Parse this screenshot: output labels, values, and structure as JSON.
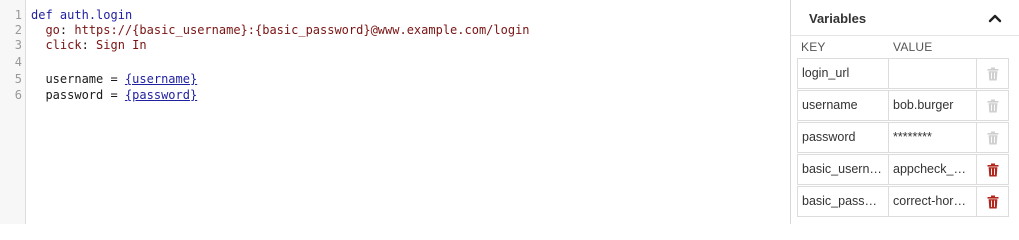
{
  "editor": {
    "line_numbers": [
      "1",
      "2",
      "3",
      "4",
      "5",
      "6"
    ],
    "line1": {
      "keyword": "def",
      "name": "auth.login"
    },
    "line2": {
      "prop": "go",
      "sep": ":",
      "url": "https://{basic_username}:{basic_password}@www.example.com/login"
    },
    "line3": {
      "prop": "click",
      "sep": ":",
      "value": "Sign In"
    },
    "line5": {
      "name": "username",
      "op": "=",
      "ref": "{username}"
    },
    "line6": {
      "name": "password",
      "op": "=",
      "ref": "{password}"
    }
  },
  "variables_panel": {
    "title": "Variables",
    "collapse_icon": "chevron-up-icon",
    "headers": {
      "key": "KEY",
      "value": "VALUE"
    },
    "rows": [
      {
        "key": "login_url",
        "value": "",
        "delete_enabled": false
      },
      {
        "key": "username",
        "value": "bob.burger",
        "delete_enabled": false
      },
      {
        "key": "password",
        "value": "********",
        "delete_enabled": false
      },
      {
        "key": "basic_username",
        "value": "appcheck_user",
        "delete_enabled": true
      },
      {
        "key": "basic_password",
        "value": "correct-horse-battery",
        "delete_enabled": true
      }
    ]
  },
  "colors": {
    "keyword": "#1f1fa0",
    "string": "#7a1414",
    "delete_active": "#b3261e",
    "delete_disabled": "#cfcfcf"
  }
}
